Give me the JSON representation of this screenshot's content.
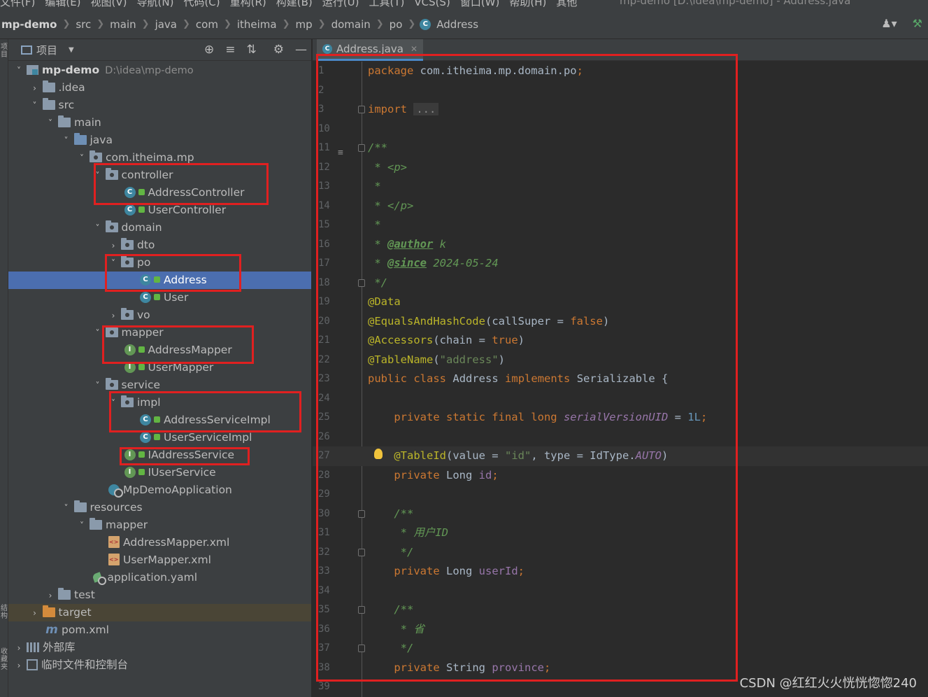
{
  "menu": {
    "items": [
      "文件(F)",
      "编辑(E)",
      "视图(V)",
      "导航(N)",
      "代码(C)",
      "重构(R)",
      "构建(B)",
      "运行(U)",
      "工具(T)",
      "VCS(S)",
      "窗口(W)",
      "帮助(H)",
      "其他"
    ],
    "window_title": "mp-demo [D:\\idea\\mp-demo] - Address.java"
  },
  "breadcrumb": {
    "items": [
      "mp-demo",
      "src",
      "main",
      "java",
      "com",
      "itheima",
      "mp",
      "domain",
      "po"
    ],
    "current": "Address",
    "current_icon": "C"
  },
  "left_strip": {
    "top_label": "项目",
    "bottom_label_1": "结构",
    "bottom_label_2": "收藏夹"
  },
  "project_panel": {
    "title": "项目",
    "tree": [
      {
        "label": "mp-demo",
        "hint": "D:\\idea\\mp-demo",
        "icon": "module",
        "arrow": "down",
        "indent": 0
      },
      {
        "label": ".idea",
        "icon": "folder",
        "arrow": "right",
        "indent": 1
      },
      {
        "label": "src",
        "icon": "folder",
        "arrow": "down",
        "indent": 1
      },
      {
        "label": "main",
        "icon": "folder",
        "arrow": "down",
        "indent": 2
      },
      {
        "label": "java",
        "icon": "folder-blue",
        "arrow": "down",
        "indent": 3
      },
      {
        "label": "com.itheima.mp",
        "icon": "package",
        "arrow": "down",
        "indent": 4
      },
      {
        "label": "controller",
        "icon": "package",
        "arrow": "down",
        "indent": 5
      },
      {
        "label": "AddressController",
        "icon": "class",
        "indent": 7
      },
      {
        "label": "UserController",
        "icon": "class",
        "indent": 7
      },
      {
        "label": "domain",
        "icon": "package",
        "arrow": "down",
        "indent": 5
      },
      {
        "label": "dto",
        "icon": "package",
        "arrow": "right",
        "indent": 6
      },
      {
        "label": "po",
        "icon": "package",
        "arrow": "down",
        "indent": 6
      },
      {
        "label": "Address",
        "icon": "class",
        "indent": 8,
        "selected": true
      },
      {
        "label": "User",
        "icon": "class",
        "indent": 8
      },
      {
        "label": "vo",
        "icon": "package",
        "arrow": "right",
        "indent": 6
      },
      {
        "label": "mapper",
        "icon": "package",
        "arrow": "down",
        "indent": 5
      },
      {
        "label": "AddressMapper",
        "icon": "interface",
        "indent": 7
      },
      {
        "label": "UserMapper",
        "icon": "interface",
        "indent": 7
      },
      {
        "label": "service",
        "icon": "package",
        "arrow": "down",
        "indent": 5
      },
      {
        "label": "impl",
        "icon": "package",
        "arrow": "down",
        "indent": 6
      },
      {
        "label": "AddressServiceImpl",
        "icon": "class",
        "indent": 8
      },
      {
        "label": "UserServiceImpl",
        "icon": "class",
        "indent": 8
      },
      {
        "label": "IAddressService",
        "icon": "interface",
        "indent": 7
      },
      {
        "label": "IUserService",
        "icon": "interface",
        "indent": 7
      },
      {
        "label": "MpDemoApplication",
        "icon": "app",
        "indent": 6
      },
      {
        "label": "resources",
        "icon": "folder",
        "arrow": "down",
        "indent": 3
      },
      {
        "label": "mapper",
        "icon": "folder",
        "arrow": "down",
        "indent": 4
      },
      {
        "label": "AddressMapper.xml",
        "icon": "xml",
        "indent": 6
      },
      {
        "label": "UserMapper.xml",
        "icon": "xml",
        "indent": 6
      },
      {
        "label": "application.yaml",
        "icon": "yaml",
        "indent": 5
      },
      {
        "label": "test",
        "icon": "folder",
        "arrow": "right",
        "indent": 2
      },
      {
        "label": "target",
        "icon": "folder-orange",
        "arrow": "right",
        "indent": 1,
        "excluded": true
      },
      {
        "label": "pom.xml",
        "icon": "maven",
        "indent": 2
      },
      {
        "label": "外部库",
        "icon": "libs",
        "arrow": "right",
        "indent": 0
      },
      {
        "label": "临时文件和控制台",
        "icon": "scratch",
        "arrow": "right",
        "indent": 0
      }
    ]
  },
  "editor": {
    "tab_label": "Address.java",
    "tab_icon": "C",
    "line_numbers": [
      "1",
      "2",
      "3",
      "10",
      "11",
      "12",
      "13",
      "14",
      "15",
      "16",
      "17",
      "18",
      "19",
      "20",
      "21",
      "22",
      "23",
      "24",
      "25",
      "26",
      "27",
      "28",
      "29",
      "30",
      "31",
      "32",
      "33",
      "34",
      "35",
      "36",
      "37",
      "38",
      "39"
    ],
    "current_line": "27",
    "code": {
      "package_kw": "package",
      "package_name": "com.itheima.mp.domain.po",
      "import_kw": "import",
      "import_folded": "...",
      "doc_open": "/**",
      "doc_p_open": " * <p>",
      "doc_star": " *",
      "doc_p_close": " * </p>",
      "doc_author_tag": "@author",
      "doc_author_val": "k",
      "doc_since_tag": "@since",
      "doc_since_val": "2024-05-24",
      "doc_close": " */",
      "ann_data": "@Data",
      "ann_equals": "@EqualsAndHashCode",
      "ann_equals_args_pre": "(callSuper = ",
      "ann_equals_val": "false",
      "ann_accessors": "@Accessors",
      "ann_accessors_args_pre": "(chain = ",
      "ann_accessors_val": "true",
      "ann_tablename": "@TableName",
      "ann_tablename_val": "\"address\"",
      "class_decl_public": "public",
      "class_decl_class": "class",
      "class_name": "Address",
      "class_implements": "implements",
      "class_iface": "Serializable {",
      "serial_mods": "private static final long",
      "serial_name": "serialVersionUID",
      "serial_eq": " = ",
      "serial_val": "1L",
      "ann_tableid": "@TableId",
      "tableid_pre": "(value = ",
      "tableid_value": "\"id\"",
      "tableid_mid": ", type = IdType.",
      "tableid_auto": "AUTO",
      "field_id_mods": "private",
      "field_id_type": "Long",
      "field_id_name": "id",
      "doc2_open": "/**",
      "doc2_text": " * 用户ID",
      "doc2_close": " */",
      "field_userid_mods": "private",
      "field_userid_type": "Long",
      "field_userid_name": "userId",
      "doc3_open": "/**",
      "doc3_text": " * 省",
      "doc3_close": " */",
      "field_province_mods": "private",
      "field_province_type": "String",
      "field_province_name": "province"
    }
  },
  "watermark": "CSDN @红红火火恍恍惚惚240",
  "colors": {
    "highlight_box": "#e02020",
    "selection": "#4b6eaf",
    "accent_tab": "#4a88c7"
  }
}
